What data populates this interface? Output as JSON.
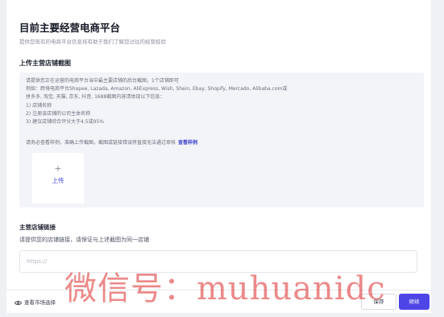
{
  "main_platform": {
    "title": "目前主要经营电商平台",
    "subtitle": "提供您现有的电商平台信息将有助于我们了解您过往的经营经验"
  },
  "upload_section": {
    "title": "上传主营店铺截图",
    "instructions": [
      "请提供您正在运营的电商平台当中最主要店铺的后台截图，1个店铺即可",
      "例如：跨境电商平台Shopee, Lazada, Amazon, AliExpress, Wish, Shein, Ebay, Shopify, Mercado, Alibaba.com或",
      "拼多多, 淘宝, 天猫, 京东, 抖音, 1688截图内容请体现以下信息：",
      "1) 店铺名称",
      "2) 注册该店铺的公司主体名称",
      "3) 建议店铺综合评分大于4.5或95%"
    ],
    "notice": "请务必查看样例，准确上传截图，截图或链接错误将直接无法通过审核",
    "sample_link": "查看样例",
    "upload_plus": "+",
    "upload_label": "上传"
  },
  "store_link": {
    "title": "主营店铺链接",
    "subtitle": "请提供您的店铺链接，请保证与上述截图为同一店铺",
    "input_value": "",
    "input_placeholder": "https://"
  },
  "footer": {
    "view_market_label": "查看市场选择",
    "save_label": "保存",
    "continue_label": "继续"
  },
  "watermark_text": "微信号：muhuanidc",
  "colors": {
    "accent": "#4d45e6",
    "link": "#3a3fd0",
    "panel_bg": "#f3f4f8",
    "watermark": "#dc2828"
  },
  "icons": {
    "view_market": "eye-icon"
  }
}
